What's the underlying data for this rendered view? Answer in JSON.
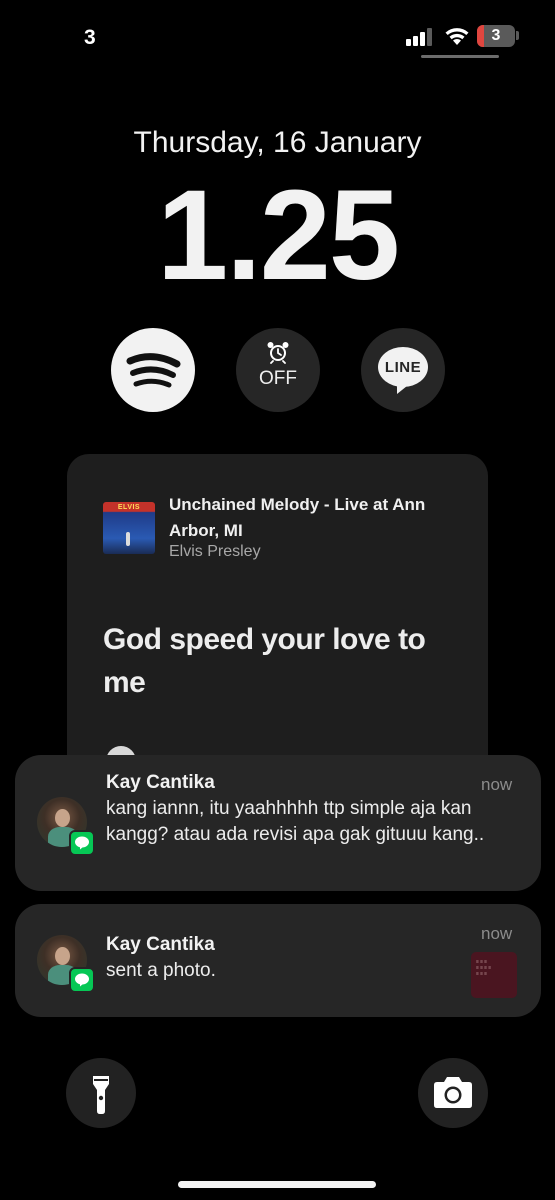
{
  "status_bar": {
    "left_text": "3",
    "battery_level": "3",
    "battery_color": "#e0463f"
  },
  "lock_screen": {
    "date": "Thursday, 16 January",
    "time": "1.25"
  },
  "widgets": {
    "spotify_icon": "spotify-icon",
    "alarm_label": "OFF",
    "line_label": "LINE"
  },
  "now_playing": {
    "title": "Unchained Melody - Live at Ann Arbor, MI",
    "artist": "Elvis Presley",
    "album_label": "ELVIS",
    "lyric": "God speed your love to me"
  },
  "notifications": [
    {
      "sender": "Kay Cantika",
      "time": "now",
      "body": "kang iannn, itu yaahhhhh ttp simple aja kan kangg? atau ada revisi apa gak gituuu kang..",
      "app_icon": "line-icon"
    },
    {
      "sender": "Kay Cantika",
      "time": "now",
      "body": "sent a photo.",
      "app_icon": "line-icon"
    }
  ],
  "controls": {
    "left": "flashlight-icon",
    "right": "camera-icon"
  },
  "colors": {
    "background": "#000000",
    "line_green": "#06c755",
    "card": "#1e1e1e",
    "notification": "#262626"
  }
}
